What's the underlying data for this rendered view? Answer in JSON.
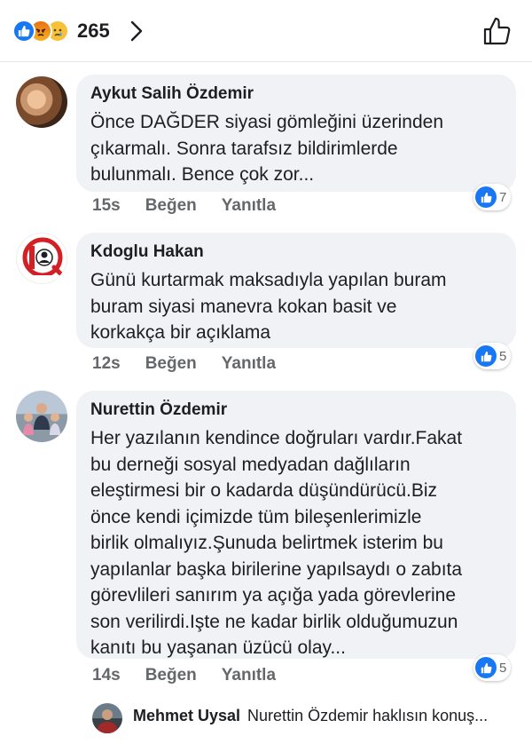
{
  "reactions": {
    "count": "265",
    "icons": [
      "like-icon",
      "angry-icon",
      "sad-icon"
    ]
  },
  "comments": [
    {
      "author": "Aykut Salih Özdemir",
      "text": "Önce DAĞDER siyasi gömleğini üzerinden\nçıkarmalı. Sonra tarafsız bildirimlerde\nbulunmalı. Bence çok zor...",
      "time": "15s",
      "like_label": "Beğen",
      "reply_label": "Yanıtla",
      "likes": "7"
    },
    {
      "author": "Kdoglu Hakan",
      "text": "Günü kurtarmak maksadıyla yapılan buram\nburam siyasi manevra kokan basit ve\nkorkakça bir açıklama",
      "time": "12s",
      "like_label": "Beğen",
      "reply_label": "Yanıtla",
      "likes": "5"
    },
    {
      "author": "Nurettin Özdemir",
      "text": "Her yazılanın kendince doğruları vardır.Fakat\nbu derneği sosyal medyadan dağlıların\neleştirmesi bir o kadarda düşündürücü.Biz\nönce kendi içimizde tüm bileşenlerimizle\nbirlik olmalıyız.Şunuda belirtmek isterim bu\nyapılanlar başka birilerine yapılsaydı o zabıta\ngörevlileri sanırım ya açığa yada görevlerine\nson verilirdi.Işte ne kadar birlik olduğumuzun\nkanıtı bu yaşanan üzücü olay...",
      "time": "14s",
      "like_label": "Beğen",
      "reply_label": "Yanıtla",
      "likes": "5"
    }
  ],
  "reply_preview": {
    "author": "Mehmet Uysal",
    "text": "Nurettin Özdemir haklısın konuş..."
  },
  "colors": {
    "brand_blue": "#1877f2",
    "bubble_bg": "#f0f2f5",
    "muted_text": "#65676b"
  }
}
